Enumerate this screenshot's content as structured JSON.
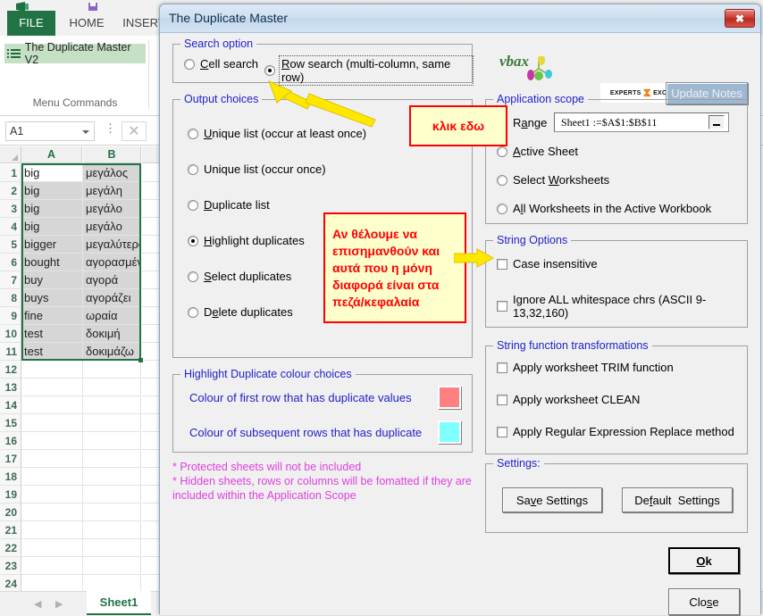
{
  "excel": {
    "ribbon_tabs": [
      {
        "label": "FILE",
        "id": "file"
      },
      {
        "label": "HOME",
        "id": "home"
      },
      {
        "label": "INSERT",
        "id": "insert"
      }
    ],
    "addin_button": "The Duplicate Master V2",
    "group_label": "Menu Commands",
    "name_box_value": "A1",
    "column_headers": [
      "A",
      "B"
    ],
    "row_numbers": [
      1,
      2,
      3,
      4,
      5,
      6,
      7,
      8,
      9,
      10,
      11,
      12,
      13,
      14,
      15,
      16,
      17,
      18,
      19,
      20,
      21,
      22,
      23,
      24
    ],
    "rows": [
      {
        "a": "big",
        "b": "μεγάλος"
      },
      {
        "a": "big",
        "b": "μεγάλη"
      },
      {
        "a": "big",
        "b": "μεγάλο"
      },
      {
        "a": "big",
        "b": "μεγάλο"
      },
      {
        "a": "bigger",
        "b": "μεγαλύτερος"
      },
      {
        "a": "bought",
        "b": "αγορασμένο"
      },
      {
        "a": "buy",
        "b": "αγορά"
      },
      {
        "a": "buys",
        "b": "αγοράζει"
      },
      {
        "a": "fine",
        "b": "ωραία"
      },
      {
        "a": "test",
        "b": "δοκιμή"
      },
      {
        "a": "test",
        "b": "δοκιμάζω"
      }
    ],
    "sheet_tab": "Sheet1"
  },
  "dialog": {
    "title": "The Duplicate Master",
    "close_label": "✖",
    "search_option": {
      "caption": "Search option",
      "options": [
        {
          "label": "Cell search",
          "accel": "C",
          "selected": false
        },
        {
          "label": "Row search (multi-column, same row)",
          "accel": "R",
          "selected": true
        }
      ]
    },
    "output_choices": {
      "caption": "Output choices",
      "options": [
        {
          "label": "Unique list (occur at least once)",
          "accel": "U",
          "selected": false
        },
        {
          "label": "Unique list (occur once)",
          "accel": "",
          "selected": false
        },
        {
          "label": "Duplicate list",
          "accel": "D",
          "selected": false
        },
        {
          "label": "Highlight duplicates",
          "accel": "H",
          "selected": true
        },
        {
          "label": "Select duplicates",
          "accel": "S",
          "selected": false
        },
        {
          "label": "Delete duplicates",
          "accel": "e",
          "selected": false
        }
      ]
    },
    "highlight_colours": {
      "caption": "Highlight Duplicate colour choices",
      "first_row_label": "Colour of first row that has duplicate values",
      "first_row_colour": "#FF8080",
      "subsequent_label": "Colour of subsequent rows that has duplicate",
      "subsequent_colour": "#80FFFF"
    },
    "footnotes": [
      "* Protected sheets will not be included",
      "* Hidden sheets, rows or columns will be fomatted if they are",
      "   included within the Application Scope"
    ],
    "application_scope": {
      "caption": "Application scope",
      "options": [
        {
          "label": "Range",
          "accel": "a",
          "selected": true
        },
        {
          "label": "Active Sheet",
          "accel": "A",
          "selected": false
        },
        {
          "label": "Select Worksheets",
          "accel": "W",
          "selected": false
        },
        {
          "label": "All Worksheets in the Active Workbook",
          "accel": "l",
          "selected": false
        }
      ],
      "range_value": "Sheet1 :=$A$1:$B$11"
    },
    "string_options": {
      "caption": "String Options",
      "items": [
        {
          "label": "Case insensitive",
          "checked": false
        },
        {
          "label": "Ignore ALL whitespace chrs (ASCII 9-13,32,160)",
          "checked": false
        }
      ]
    },
    "string_transformations": {
      "caption": "String function transformations",
      "items": [
        {
          "label": "Apply worksheet TRIM function",
          "checked": false
        },
        {
          "label": "Apply worksheet CLEAN",
          "checked": false
        },
        {
          "label": "Apply Regular Expression Replace method",
          "checked": false
        }
      ]
    },
    "settings": {
      "caption": "Settings:",
      "save_label": "Save Settings",
      "default_label": "Default  Settings"
    },
    "ok_label": "Ok",
    "close_button_label": "Close",
    "update_notes_label": "Update Notes",
    "vbax_logo_text": "vbax",
    "ee_logo_left": "EXPERTS",
    "ee_logo_right": "EXCHANGE"
  },
  "annotations": {
    "callout_click_here": "κλικ εδω",
    "callout_note": "Αν θέλουμε να επισημανθούν και αυτά που η μόνη διαφορά είναι στα πεζά/κεφαλαία}",
    "arrow_colour": "#FFFF00"
  }
}
